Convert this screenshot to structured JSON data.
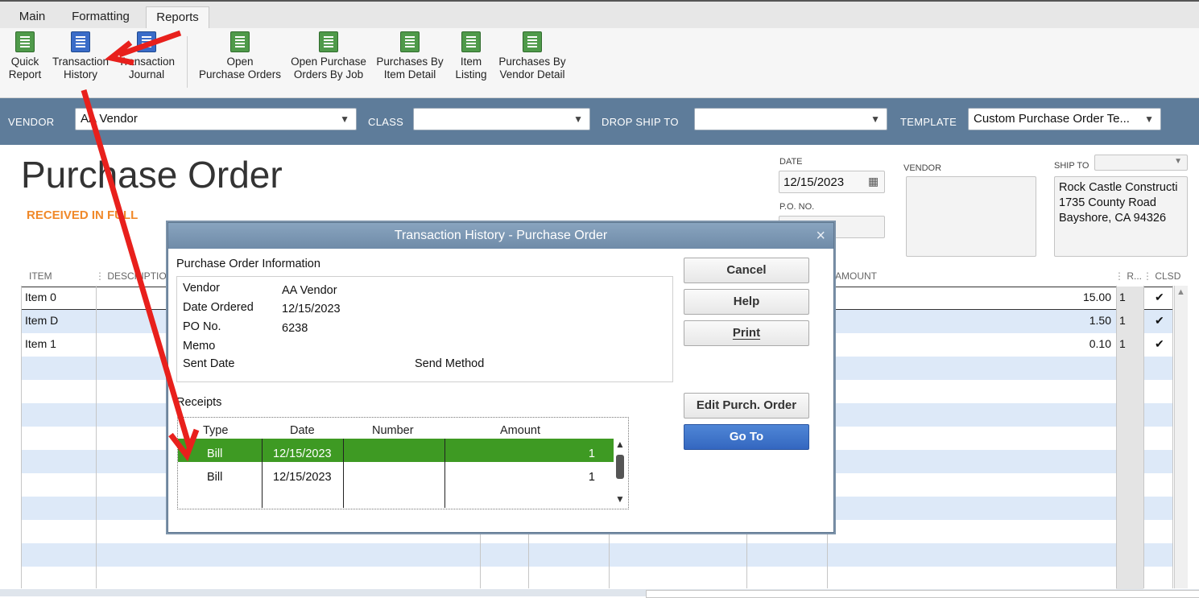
{
  "ribbon": {
    "tabs": [
      "Main",
      "Formatting",
      "Reports"
    ],
    "buttons": {
      "quick_report": [
        "Quick",
        "Report"
      ],
      "transaction_history": [
        "Transaction",
        "History"
      ],
      "transaction_journal": [
        "Transaction",
        "Journal"
      ],
      "open_purchase_orders": [
        "Open",
        "Purchase Orders"
      ],
      "open_purchase_orders_by_job": [
        "Open Purchase",
        "Orders By Job"
      ],
      "purchases_by_item_detail": [
        "Purchases By",
        "Item Detail"
      ],
      "item_listing": [
        "Item",
        "Listing"
      ],
      "purchases_by_vendor_detail": [
        "Purchases By",
        "Vendor Detail"
      ]
    }
  },
  "vendor_bar": {
    "vendor_label": "VENDOR",
    "vendor_value": "AA Vendor",
    "class_label": "CLASS",
    "class_value": "",
    "drop_ship_label": "DROP SHIP TO",
    "drop_ship_value": "",
    "template_label": "TEMPLATE",
    "template_value": "Custom Purchase Order Te..."
  },
  "form": {
    "title": "Purchase Order",
    "status": "RECEIVED IN FULL",
    "date_label": "DATE",
    "date_value": "12/15/2023",
    "po_no_label": "P.O. NO.",
    "vendor_label": "VENDOR",
    "ship_to_label": "SHIP TO",
    "ship_to_lines": [
      "Rock Castle Constructi",
      "1735 County Road",
      "Bayshore, CA 94326"
    ]
  },
  "grid": {
    "headers": {
      "item": "ITEM",
      "description": "DESCRIPTIO",
      "amount": "AMOUNT",
      "r": "R...",
      "clsd": "CLSD"
    },
    "rows": [
      {
        "item": "Item 0",
        "amount": "15.00",
        "r": "1",
        "clsd": "✔"
      },
      {
        "item": "Item D",
        "amount": "1.50",
        "r": "1",
        "clsd": "✔"
      },
      {
        "item": "Item 1",
        "amount": "0.10",
        "r": "1",
        "clsd": "✔"
      }
    ]
  },
  "dialog": {
    "title": "Transaction History - Purchase Order",
    "close": "×",
    "section_label": "Purchase Order Information",
    "info": {
      "vendor_label": "Vendor",
      "vendor_value": "AA Vendor",
      "date_ordered_label": "Date Ordered",
      "date_ordered_value": "12/15/2023",
      "po_no_label": "PO No.",
      "po_no_value": "6238",
      "memo_label": "Memo",
      "sent_date_label": "Sent Date",
      "send_method_label": "Send Method"
    },
    "receipts_label": "Receipts",
    "receipts_headers": [
      "Type",
      "Date",
      "Number",
      "Amount"
    ],
    "receipts": [
      {
        "type": "Bill",
        "date": "12/15/2023",
        "number": "",
        "amount": "1"
      },
      {
        "type": "Bill",
        "date": "12/15/2023",
        "number": "",
        "amount": "1"
      }
    ],
    "buttons": {
      "cancel": "Cancel",
      "help": "Help",
      "print": "Print",
      "edit_purch_order": "Edit Purch. Order",
      "go_to": "Go To"
    }
  },
  "colors": {
    "vendor_bar": "#5e7c9a",
    "status": "#f0892a",
    "grid_alt": "#dde9f8",
    "selected_row": "#3e9a23",
    "annotation_arrow": "#e8201c",
    "primary_button": "#3a6cc8"
  }
}
